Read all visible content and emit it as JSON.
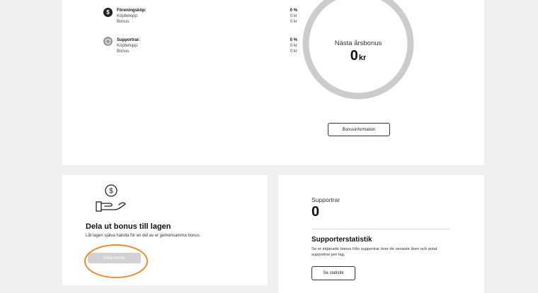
{
  "bonus_rows": [
    {
      "icon": "dollar-icon",
      "title": "Föreningsköp:",
      "title_value": "0 %",
      "lines": [
        {
          "label": "Köpbelopp:",
          "value": "0 kr"
        },
        {
          "label": "Bonus:",
          "value": "0 kr"
        }
      ]
    },
    {
      "icon": "shield-icon",
      "title": "Supportrar:",
      "title_value": "0 %",
      "lines": [
        {
          "label": "Köpbelopp:",
          "value": "0 kr"
        },
        {
          "label": "Bonus:",
          "value": "0 kr"
        }
      ]
    }
  ],
  "gauge": {
    "label": "Nästa årsbonus",
    "value": "0",
    "unit": "kr",
    "fill": 0
  },
  "bonus_info_button": "Bonusinformation",
  "share": {
    "icon": "hand-coin-icon",
    "title": "Dela ut bonus till lagen",
    "description": "Låt lagen själva handla för en del av er gemensamma bonus.",
    "button": "Dela bonus"
  },
  "supporters": {
    "label": "Supportrar",
    "count": "0",
    "stats_title": "Supporterstatistik",
    "stats_description": "Se er intjänade bonus från supportrar över de senaste åren och antal supportrar per lag.",
    "button": "Se statistik"
  },
  "colors": {
    "page_bg": "#f0f0f0",
    "card_bg": "#ffffff",
    "gauge_ring": "#cccccc",
    "highlight_ring": "#f08a30",
    "disabled_button": "#d2d2d2",
    "dollar_badge": "#222222",
    "shield_badge": "#9a9a9a"
  }
}
